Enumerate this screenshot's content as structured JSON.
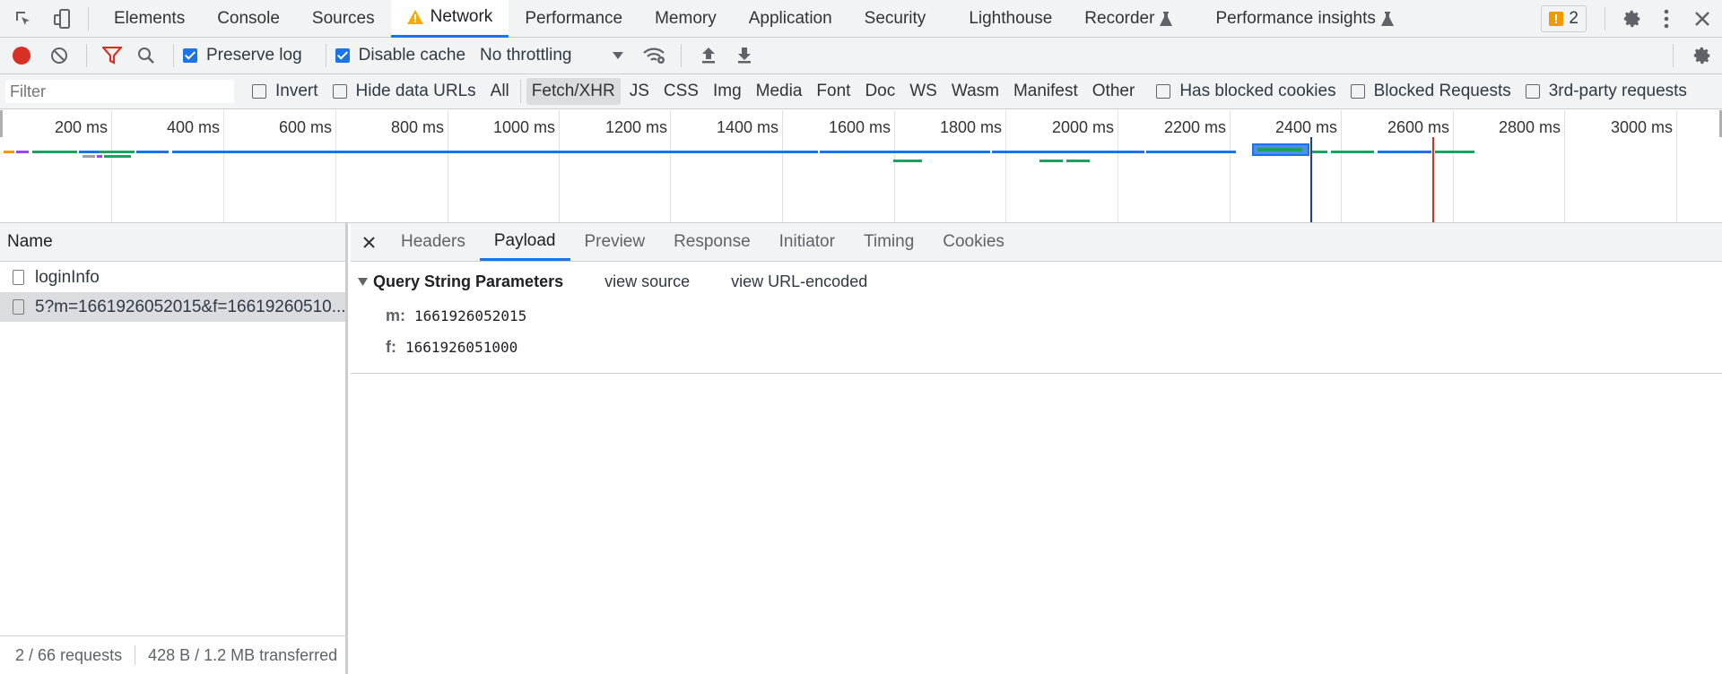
{
  "main_tabs": [
    {
      "label": "Elements"
    },
    {
      "label": "Console"
    },
    {
      "label": "Sources"
    },
    {
      "label": "Network"
    },
    {
      "label": "Performance"
    },
    {
      "label": "Memory"
    },
    {
      "label": "Application"
    },
    {
      "label": "Security"
    },
    {
      "label": "Lighthouse"
    },
    {
      "label": "Recorder"
    },
    {
      "label": "Performance insights"
    }
  ],
  "active_main_tab": "Network",
  "issues_count": "2",
  "toolbar": {
    "preserve_log_label": "Preserve log",
    "preserve_log_checked": true,
    "disable_cache_label": "Disable cache",
    "disable_cache_checked": true,
    "throttling_value": "No throttling"
  },
  "filter_bar": {
    "placeholder": "Filter",
    "invert_label": "Invert",
    "hide_data_urls_label": "Hide data URLs",
    "types": [
      "All",
      "Fetch/XHR",
      "JS",
      "CSS",
      "Img",
      "Media",
      "Font",
      "Doc",
      "WS",
      "Wasm",
      "Manifest",
      "Other"
    ],
    "active_type": "Fetch/XHR",
    "has_blocked_cookies_label": "Has blocked cookies",
    "blocked_requests_label": "Blocked Requests",
    "third_party_label": "3rd-party requests"
  },
  "overview": {
    "tick_labels": [
      "200 ms",
      "400 ms",
      "600 ms",
      "800 ms",
      "1000 ms",
      "1200 ms",
      "1400 ms",
      "1600 ms",
      "1800 ms",
      "2000 ms",
      "2200 ms",
      "2400 ms",
      "2600 ms",
      "2800 ms",
      "3000 ms"
    ]
  },
  "requests": {
    "column_header": "Name",
    "items": [
      {
        "name": "loginInfo"
      },
      {
        "name": "5?m=1661926052015&f=16619260510..."
      }
    ],
    "status_requests": "2 / 66 requests",
    "status_transferred": "428 B / 1.2 MB transferred"
  },
  "detail": {
    "tabs": [
      {
        "label": "Headers"
      },
      {
        "label": "Payload"
      },
      {
        "label": "Preview"
      },
      {
        "label": "Response"
      },
      {
        "label": "Initiator"
      },
      {
        "label": "Timing"
      },
      {
        "label": "Cookies"
      }
    ],
    "active_tab": "Payload",
    "section_title": "Query String Parameters",
    "view_source": "view source",
    "view_url_encoded": "view URL-encoded",
    "params": [
      {
        "key": "m:",
        "value": "1661926052015"
      },
      {
        "key": "f:",
        "value": "1661926051000"
      }
    ]
  },
  "colors": {
    "accent": "#1a73e8",
    "record": "#d93025",
    "warning": "#f9ab00",
    "issue_badge": "#f29900"
  }
}
